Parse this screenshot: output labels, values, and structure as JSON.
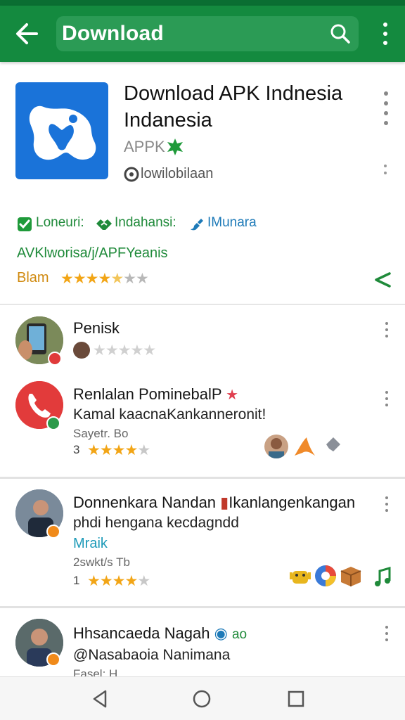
{
  "appbar": {
    "title": "Download",
    "icons": [
      "back-arrow-icon",
      "search-icon",
      "overflow-menu-icon"
    ],
    "colors": {
      "bar": "#148a3f",
      "search_bg": "#2b9b55"
    }
  },
  "app": {
    "title_line1": "Download APK Indnesia",
    "title_line2": "Indanesia",
    "category": "APPK",
    "developer": "lowilobilaan",
    "icon_color": "#1a73d9"
  },
  "tags": [
    {
      "label": "Loneuri:",
      "icon": "check-badge-icon",
      "color": "#1f8a3a"
    },
    {
      "label": "Indahansi:",
      "icon": "handshake-icon",
      "color": "#1f8a3a"
    },
    {
      "label": "IMunara",
      "icon": "paint-icon",
      "color": "#1d7ab8"
    }
  ],
  "subtitle": "AVKlworisa/j/APFYeanis",
  "rating": {
    "label": "Blam",
    "stars_filled": 4.5,
    "stars_total": 6
  },
  "items": [
    {
      "title": "Penisk",
      "stars_filled": 0,
      "stars_total": 5
    },
    {
      "title": "Renlalan PominebalP",
      "subtitle": "Kamal kaacnaKankanneronit!",
      "meta": "Sayetr. Bo",
      "rating_count": "3",
      "stars_filled": 4,
      "stars_total": 5
    },
    {
      "title": "Donnenkara Nandan",
      "title_suffix": "Ikanlangenkangan",
      "subtitle": "phdi hengana kecdagndd",
      "link": "Mraik",
      "meta": "2swkt/s Tb",
      "rating_count": "1",
      "stars_filled": 4,
      "stars_total": 5
    },
    {
      "title": "Hhsancaeda Nagah",
      "title_suffix": "ao",
      "subtitle": "@Nasabaoia Nanimana",
      "meta": "Fasel: H"
    }
  ],
  "navbar": {
    "buttons": [
      "back-nav-icon",
      "home-nav-icon",
      "recents-nav-icon"
    ]
  },
  "colors": {
    "accent_green": "#1f8a3a",
    "star": "#f2a516",
    "star_empty": "#c8c8c8"
  }
}
